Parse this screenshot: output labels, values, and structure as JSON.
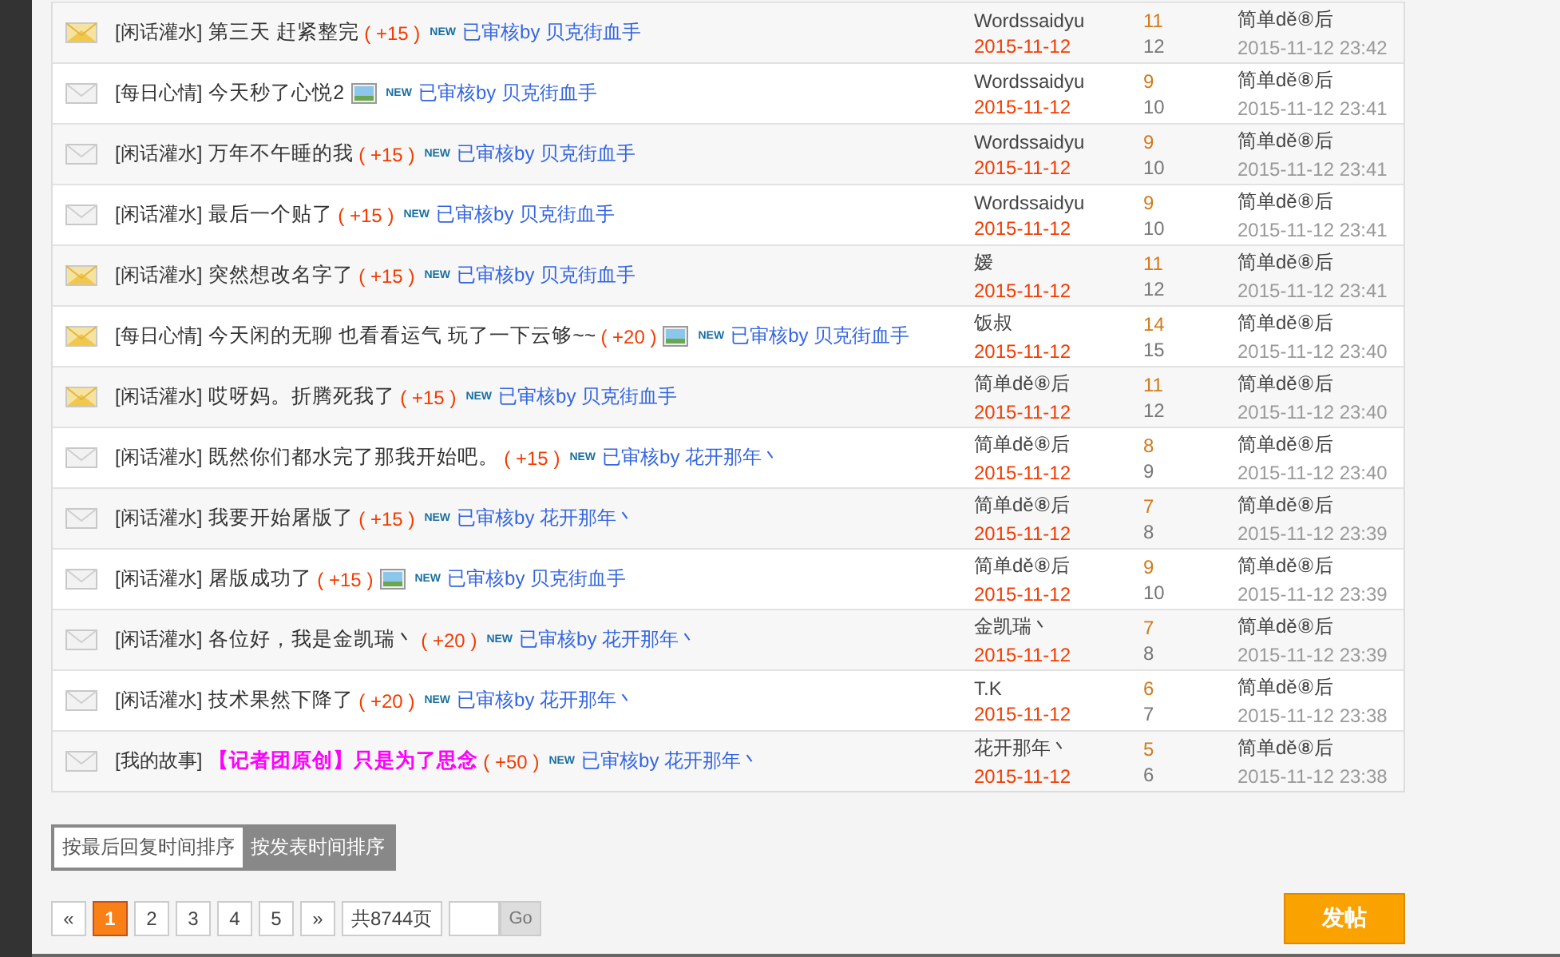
{
  "threads": [
    {
      "hot": true,
      "category": "[闲话灌水]",
      "title": "第三天 赶紧整完",
      "highlighted": false,
      "points": "( +15 )",
      "has_image": false,
      "badge": "NEW",
      "review": "已审核by 贝克街血手",
      "author": "Wordssaidyu",
      "date": "2015-11-12",
      "replies": "11",
      "views": "12",
      "last_poster": "简单dě⑧后",
      "last_time": "2015-11-12 23:42"
    },
    {
      "hot": false,
      "category": "[每日心情]",
      "title": "今天秒了心悦2",
      "highlighted": false,
      "has_image": true,
      "badge": "NEW",
      "review": "已审核by 贝克街血手",
      "author": "Wordssaidyu",
      "date": "2015-11-12",
      "replies": "9",
      "views": "10",
      "last_poster": "简单dě⑧后",
      "last_time": "2015-11-12 23:41"
    },
    {
      "hot": false,
      "category": "[闲话灌水]",
      "title": "万年不午睡的我",
      "highlighted": false,
      "points": "( +15 )",
      "has_image": false,
      "badge": "NEW",
      "review": "已审核by 贝克街血手",
      "author": "Wordssaidyu",
      "date": "2015-11-12",
      "replies": "9",
      "views": "10",
      "last_poster": "简单dě⑧后",
      "last_time": "2015-11-12 23:41"
    },
    {
      "hot": false,
      "category": "[闲话灌水]",
      "title": "最后一个贴了",
      "highlighted": false,
      "points": "( +15 )",
      "has_image": false,
      "badge": "NEW",
      "review": "已审核by 贝克街血手",
      "author": "Wordssaidyu",
      "date": "2015-11-12",
      "replies": "9",
      "views": "10",
      "last_poster": "简单dě⑧后",
      "last_time": "2015-11-12 23:41"
    },
    {
      "hot": true,
      "category": "[闲话灌水]",
      "title": "突然想改名字了",
      "highlighted": false,
      "points": "( +15 )",
      "has_image": false,
      "badge": "NEW",
      "review": "已审核by 贝克街血手",
      "author": "嫒",
      "date": "2015-11-12",
      "replies": "11",
      "views": "12",
      "last_poster": "简单dě⑧后",
      "last_time": "2015-11-12 23:41"
    },
    {
      "hot": true,
      "category": "[每日心情]",
      "title": "今天闲的无聊  也看看运气 玩了一下云够~~",
      "highlighted": false,
      "points": "( +20 )",
      "has_image": true,
      "badge": "NEW",
      "review": "已审核by 贝克街血手",
      "author": "饭叔",
      "date": "2015-11-12",
      "replies": "14",
      "views": "15",
      "last_poster": "简单dě⑧后",
      "last_time": "2015-11-12 23:40"
    },
    {
      "hot": true,
      "category": "[闲话灌水]",
      "title": "哎呀妈。折腾死我了",
      "highlighted": false,
      "points": "( +15 )",
      "has_image": false,
      "badge": "NEW",
      "review": "已审核by 贝克街血手",
      "author": "简单dě⑧后",
      "date": "2015-11-12",
      "replies": "11",
      "views": "12",
      "last_poster": "简单dě⑧后",
      "last_time": "2015-11-12 23:40"
    },
    {
      "hot": false,
      "category": "[闲话灌水]",
      "title": "既然你们都水完了那我开始吧。",
      "highlighted": false,
      "points": "( +15 )",
      "has_image": false,
      "badge": "NEW",
      "review": "已审核by 花开那年丶",
      "author": "简单dě⑧后",
      "date": "2015-11-12",
      "replies": "8",
      "views": "9",
      "last_poster": "简单dě⑧后",
      "last_time": "2015-11-12 23:40"
    },
    {
      "hot": false,
      "category": "[闲话灌水]",
      "title": "我要开始屠版了",
      "highlighted": false,
      "points": "( +15 )",
      "has_image": false,
      "badge": "NEW",
      "review": "已审核by 花开那年丶",
      "author": "简单dě⑧后",
      "date": "2015-11-12",
      "replies": "7",
      "views": "8",
      "last_poster": "简单dě⑧后",
      "last_time": "2015-11-12 23:39"
    },
    {
      "hot": false,
      "category": "[闲话灌水]",
      "title": "屠版成功了",
      "highlighted": false,
      "points": "( +15 )",
      "has_image": true,
      "badge": "NEW",
      "review": "已审核by 贝克街血手",
      "author": "简单dě⑧后",
      "date": "2015-11-12",
      "replies": "9",
      "views": "10",
      "last_poster": "简单dě⑧后",
      "last_time": "2015-11-12 23:39"
    },
    {
      "hot": false,
      "category": "[闲话灌水]",
      "title": "各位好，我是金凯瑞丶",
      "highlighted": false,
      "points": "( +20 )",
      "has_image": false,
      "badge": "NEW",
      "review": "已审核by 花开那年丶",
      "author": "金凯瑞丶",
      "date": "2015-11-12",
      "replies": "7",
      "views": "8",
      "last_poster": "简单dě⑧后",
      "last_time": "2015-11-12 23:39"
    },
    {
      "hot": false,
      "category": "[闲话灌水]",
      "title": "技术果然下降了",
      "highlighted": false,
      "points": "( +20 )",
      "has_image": false,
      "badge": "NEW",
      "review": "已审核by 花开那年丶",
      "author": "T.K",
      "date": "2015-11-12",
      "replies": "6",
      "views": "7",
      "last_poster": "简单dě⑧后",
      "last_time": "2015-11-12 23:38"
    },
    {
      "hot": false,
      "category": "[我的故事]",
      "title": "【记者团原创】只是为了思念",
      "highlighted": true,
      "points": "( +50 )",
      "has_image": false,
      "badge": "NEW",
      "review": "已审核by 花开那年丶",
      "author": "花开那年丶",
      "date": "2015-11-12",
      "replies": "5",
      "views": "6",
      "last_poster": "简单dě⑧后",
      "last_time": "2015-11-12 23:38"
    }
  ],
  "sort_options": [
    {
      "label": "按最后回复时间排序",
      "selected": true
    },
    {
      "label": "按发表时间排序",
      "selected": false
    }
  ],
  "pagination": {
    "prev": "«",
    "pages": [
      {
        "label": "1",
        "selected": true
      },
      {
        "label": "2",
        "selected": false
      },
      {
        "label": "3",
        "selected": false
      },
      {
        "label": "4",
        "selected": false
      },
      {
        "label": "5",
        "selected": false
      }
    ],
    "next": "»",
    "total": "共8744页",
    "go": "Go"
  },
  "post_button": "发帖"
}
